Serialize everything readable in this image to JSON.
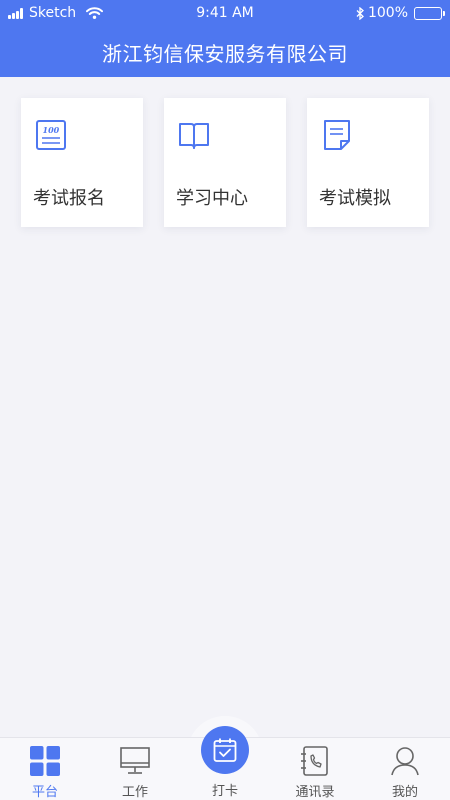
{
  "status_bar": {
    "carrier": "Sketch",
    "time": "9:41 AM",
    "battery": "100%",
    "battery_level": 1.0
  },
  "header": {
    "title": "浙江钧信保安服务有限公司"
  },
  "cards": [
    {
      "label": "考试报名",
      "icon": "exam-register-icon"
    },
    {
      "label": "学习中心",
      "icon": "open-book-icon"
    },
    {
      "label": "考试模拟",
      "icon": "document-icon"
    }
  ],
  "tabbar": {
    "tabs": [
      {
        "label": "平台",
        "icon": "grid-icon",
        "active": true
      },
      {
        "label": "工作",
        "icon": "monitor-icon",
        "active": false
      },
      {
        "label": "打卡",
        "icon": "checkin-calendar-icon",
        "active": false
      },
      {
        "label": "通讯录",
        "icon": "contacts-phone-icon",
        "active": false
      },
      {
        "label": "我的",
        "icon": "user-icon",
        "active": false
      }
    ]
  },
  "colors": {
    "brand": "#4e77f0",
    "background": "#f3f3f8",
    "card": "#ffffff",
    "tabbar": "#f8f8fb"
  }
}
